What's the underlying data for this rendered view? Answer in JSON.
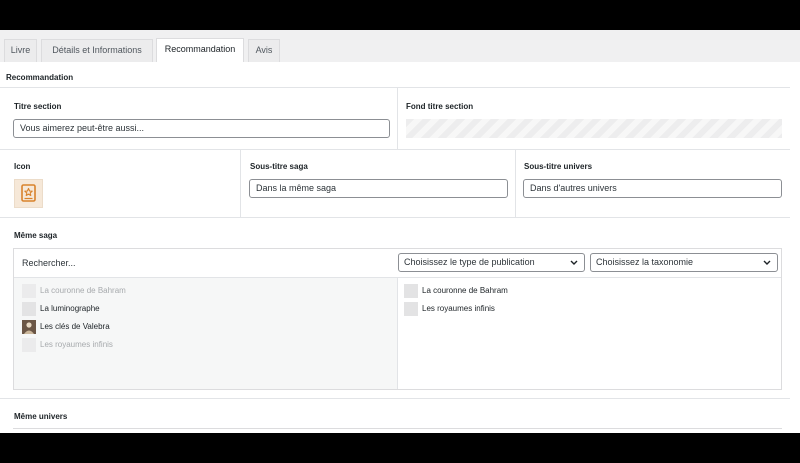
{
  "tabs": [
    {
      "label": "Livre"
    },
    {
      "label": "Détails et Informations"
    },
    {
      "label": "Recommandation"
    },
    {
      "label": "Avis"
    }
  ],
  "section": {
    "title": "Recommandation"
  },
  "fields": {
    "titre_section": {
      "label": "Titre section",
      "value": "Vous aimerez peut-être aussi..."
    },
    "fond_titre_section": {
      "label": "Fond titre section"
    },
    "icon": {
      "label": "Icon",
      "icon_name": "star-badge-icon",
      "color": "#d9822b"
    },
    "sous_titre_saga": {
      "label": "Sous-titre saga",
      "value": "Dans la même saga"
    },
    "sous_titre_univers": {
      "label": "Sous-titre univers",
      "value": "Dans d'autres univers"
    }
  },
  "meme_saga": {
    "label": "Même saga",
    "search_placeholder": "Rechercher...",
    "filter_type": "Choisissez le type de publication",
    "filter_taxonomy": "Choisissez la taxonomie",
    "available": [
      {
        "title": "La couronne de Bahram",
        "disabled": true
      },
      {
        "title": "La luminographe",
        "disabled": false
      },
      {
        "title": "Les clés de Valebra",
        "disabled": false,
        "has_cover": true
      },
      {
        "title": "Les royaumes infinis",
        "disabled": true
      }
    ],
    "selected": [
      {
        "title": "La couronne de Bahram"
      },
      {
        "title": "Les royaumes infinis"
      }
    ]
  },
  "meme_univers": {
    "label": "Même univers"
  }
}
